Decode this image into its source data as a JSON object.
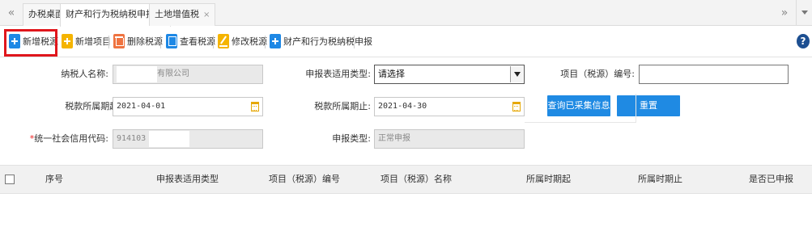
{
  "tabs": {
    "nav_left": "«",
    "nav_right": "»",
    "items": [
      {
        "label": "办税桌面",
        "closable": false
      },
      {
        "label": "财产和行为税纳税申报",
        "closable": true
      },
      {
        "label": "土地增值税",
        "closable": true
      }
    ],
    "close_glyph": "×"
  },
  "toolbar": {
    "buttons": [
      {
        "label": "新增税源",
        "icon": "plus-icon",
        "color": "#1e88e5"
      },
      {
        "label": "新增项目",
        "icon": "plus-icon",
        "color": "#f5b400"
      },
      {
        "label": "删除税源",
        "icon": "trash-icon",
        "color": "#ef7340"
      },
      {
        "label": "查看税源",
        "icon": "view-icon",
        "color": "#1e88e5"
      },
      {
        "label": "修改税源",
        "icon": "edit-icon",
        "color": "#f5b400"
      },
      {
        "label": "财产和行为税纳税申报",
        "icon": "plus-icon",
        "color": "#1e88e5"
      }
    ],
    "help": "?",
    "highlight_color": "#e0161c"
  },
  "form": {
    "taxpayer_name": {
      "label": "纳税人名称:",
      "value": "有限公司"
    },
    "form_type": {
      "label": "申报表适用类型:",
      "value": "请选择"
    },
    "project_no": {
      "label": "项目（税源）编号:",
      "value": ""
    },
    "period_start": {
      "label": "税款所属期起:",
      "value": "2021-04-01"
    },
    "period_end": {
      "label": "税款所属期止:",
      "value": "2021-04-30"
    },
    "credit_code": {
      "required_mark": "*",
      "label": "统一社会信用代码:",
      "value": "914103"
    },
    "declare_type": {
      "label": "申报类型:",
      "value": "正常申报"
    },
    "query_button": "查询已采集信息",
    "reset_button": "重置",
    "button_color": "#1f8ae3"
  },
  "table": {
    "columns": [
      "序号",
      "申报表适用类型",
      "项目（税源）编号",
      "项目（税源）名称",
      "所属时期起",
      "所属时期止",
      "是否已申报"
    ],
    "rows": []
  }
}
